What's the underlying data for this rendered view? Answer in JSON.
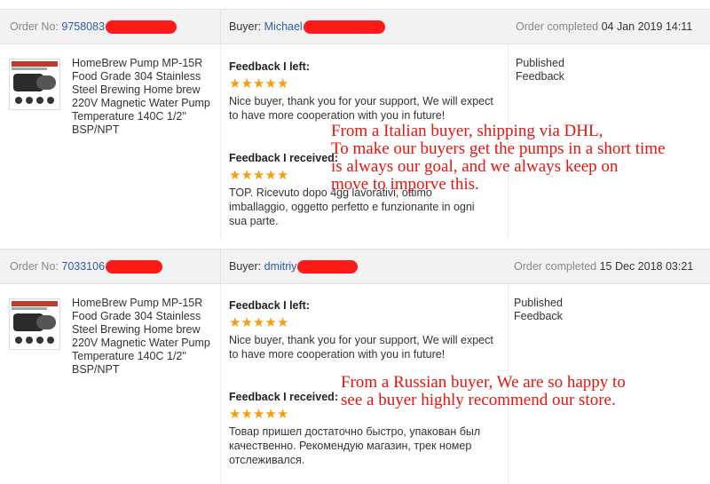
{
  "labels": {
    "order_no": "Order No:",
    "buyer": "Buyer:",
    "order_completed": "Order completed",
    "feedback_left": "Feedback I left:",
    "feedback_received": "Feedback I received:",
    "status": "Published\nFeedback"
  },
  "orders": [
    {
      "order_number_visible": "9758083",
      "buyer_name_visible": "Michael",
      "completed_date": "04 Jan 2019 14:11",
      "product_name": "HomeBrew Pump MP-15R Food Grade 304 Stainless Steel Brewing Home brew 220V Magnetic Water Pump Temperature 140C 1/2\" BSP/NPT",
      "feedback_left_text": "Nice buyer, thank you for your support, We will expect to have more cooperation with you in future!",
      "feedback_left_rating": 5,
      "feedback_received_text": "TOP. Ricevuto dopo 4gg lavorativi, ottimo imballaggio, oggetto perfetto e funzionante in ogni sua parte.",
      "feedback_received_rating": 5,
      "status": "Published Feedback",
      "annotation": [
        "From a Italian buyer,  shipping via DHL,",
        "To make our buyers get the pumps in a short time",
        "is always our goal, and we always keep on",
        "move to imporve this."
      ]
    },
    {
      "order_number_visible": "7033106",
      "buyer_name_visible": "dmitriy",
      "completed_date": "15 Dec 2018 03:21",
      "product_name": "HomeBrew Pump MP-15R Food Grade 304 Stainless Steel Brewing Home brew 220V Magnetic Water Pump Temperature 140C 1/2\" BSP/NPT",
      "feedback_left_text": "Nice buyer, thank you for your support, We will expect to have more cooperation with you in future!",
      "feedback_left_rating": 5,
      "feedback_received_text": "Товар пришел достаточно быстро, упакован был качественно. Рекомендую магазин, трек номер отслеживался.",
      "feedback_received_rating": 5,
      "status": "Published Feedback",
      "annotation": [
        "From a Russian buyer, We are so happy to",
        "see a buyer highly recommend our store."
      ]
    }
  ],
  "colors": {
    "link_blue": "#2a5db0",
    "star_orange": "#f49d13",
    "annotation_red": "#e8140e",
    "redaction_red": "#ff1a1a",
    "header_bg": "#f2f2f2"
  },
  "icons": {
    "star": "star-icon",
    "product_thumbnail": "pump-product-image"
  }
}
